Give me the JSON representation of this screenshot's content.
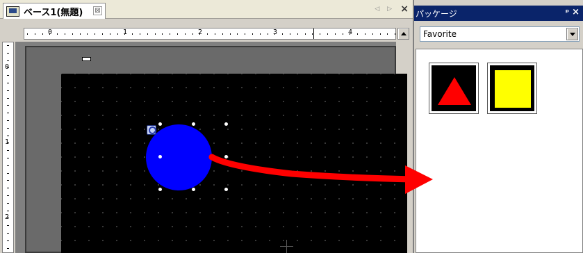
{
  "editor": {
    "tab_title": "ベース1(無題)",
    "tab_close": "⊠",
    "nav_buttons": "◁ ▷",
    "close_glyph": "×",
    "hruler": {
      "labels": [
        "0",
        "1",
        "2",
        "3",
        "4"
      ]
    },
    "vruler": {
      "labels": [
        "0",
        "1",
        "2"
      ]
    },
    "circle_color": "#0000ff"
  },
  "package_panel": {
    "title": "パッケージ",
    "pin_glyph": "ᵖ",
    "close_glyph": "×",
    "category_select": {
      "value": "Favorite"
    },
    "items": [
      {
        "name": "red-triangle",
        "shape": "triangle",
        "color": "#ff0000"
      },
      {
        "name": "yellow-square",
        "shape": "square",
        "color": "#ffff00"
      }
    ]
  },
  "annotation": {
    "arrow_color": "#ff0000"
  }
}
